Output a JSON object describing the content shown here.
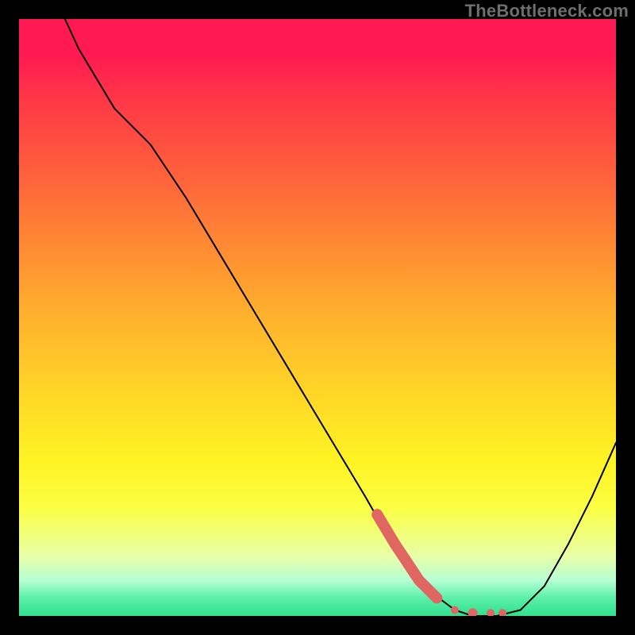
{
  "watermark": "TheBottleneck.com",
  "chart_data": {
    "type": "line",
    "title": "",
    "xlabel": "",
    "ylabel": "",
    "xlim": [
      0,
      100
    ],
    "ylim": [
      0,
      100
    ],
    "x": [
      0,
      4,
      10,
      16,
      22,
      28,
      34,
      40,
      46,
      52,
      58,
      62,
      65,
      69,
      73,
      76,
      80,
      84,
      88,
      92,
      96,
      100
    ],
    "values": [
      120,
      108,
      95,
      85,
      79,
      70,
      60,
      50,
      40,
      30,
      20,
      13,
      10,
      4,
      1,
      0,
      0,
      1,
      5,
      12,
      20,
      29
    ],
    "highlight": {
      "x": [
        60,
        63,
        65,
        67,
        70,
        73,
        76,
        79,
        81
      ],
      "values": [
        17,
        12,
        9,
        6,
        3,
        1,
        0.5,
        0.5,
        0.5
      ]
    },
    "gradient_stops": [
      {
        "pos": 0.0,
        "color": "#ff1a53"
      },
      {
        "pos": 0.5,
        "color": "#ffb22d"
      },
      {
        "pos": 0.8,
        "color": "#fbff44"
      },
      {
        "pos": 1.0,
        "color": "#2fe08f"
      }
    ]
  }
}
